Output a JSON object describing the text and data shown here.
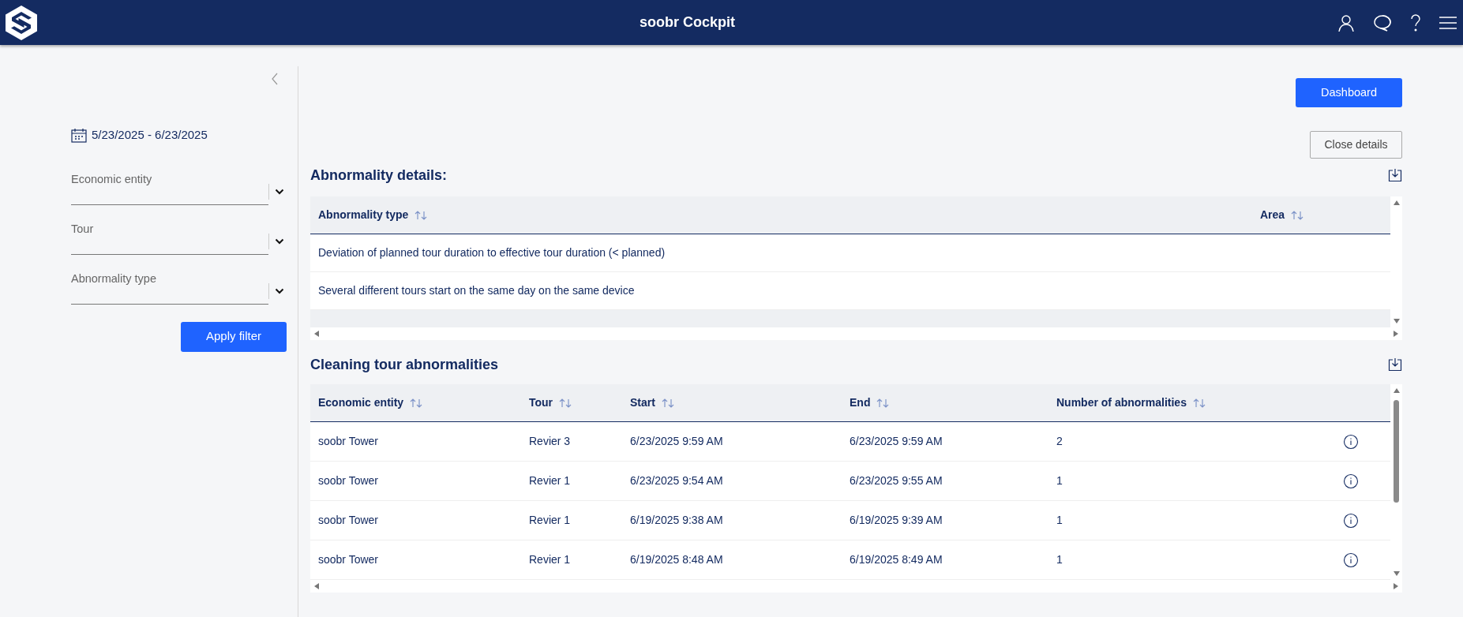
{
  "header": {
    "title": "soobr Cockpit"
  },
  "sidebar": {
    "date_range": "5/23/2025 - 6/23/2025",
    "filters": [
      {
        "placeholder": "Economic entity"
      },
      {
        "placeholder": "Tour"
      },
      {
        "placeholder": "Abnormality type"
      }
    ],
    "apply_button": "Apply filter"
  },
  "buttons": {
    "dashboard": "Dashboard",
    "close_details": "Close details"
  },
  "details": {
    "title": "Abnormality details:",
    "columns": [
      "Abnormality type",
      "Area"
    ],
    "rows": [
      [
        "Deviation of planned tour duration to effective tour duration (< planned)",
        ""
      ],
      [
        "Several different tours start on the same day on the same device",
        ""
      ]
    ]
  },
  "abnormalities": {
    "title": "Cleaning tour abnormalities",
    "columns": [
      "Economic entity",
      "Tour",
      "Start",
      "End",
      "Number of abnormalities"
    ],
    "rows": [
      [
        "soobr Tower",
        "Revier 3",
        "6/23/2025 9:59 AM",
        "6/23/2025 9:59 AM",
        "2"
      ],
      [
        "soobr Tower",
        "Revier 1",
        "6/23/2025 9:54 AM",
        "6/23/2025 9:55 AM",
        "1"
      ],
      [
        "soobr Tower",
        "Revier 1",
        "6/19/2025 9:38 AM",
        "6/19/2025 9:39 AM",
        "1"
      ],
      [
        "soobr Tower",
        "Revier 1",
        "6/19/2025 8:48 AM",
        "6/19/2025 8:49 AM",
        "1"
      ]
    ]
  }
}
